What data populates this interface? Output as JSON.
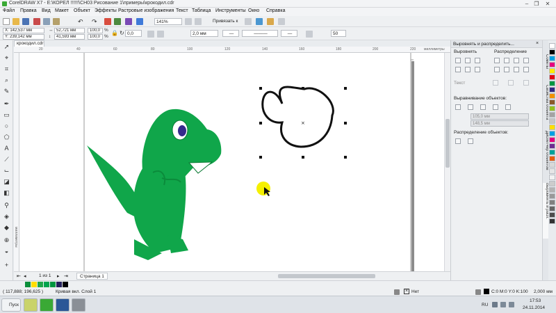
{
  "window": {
    "title": "CorelDRAW X7 - E:\\КОРЕЛ !!!!!!\\CH03 Рисование 1\\примеры\\крокодил.cdr"
  },
  "menu": [
    "Файл",
    "Правка",
    "Вид",
    "Макет",
    "Объект",
    "Эффекты",
    "Растровые изображения",
    "Текст",
    "Таблица",
    "Инструменты",
    "Окно",
    "Справка"
  ],
  "toolbar": {
    "zoom": "141%",
    "snap_label": "Привязать к"
  },
  "propbar": {
    "x": "X: 142,537 мм",
    "y": "Y: 239,142 мм",
    "width": "52,721 мм",
    "height": "41,593 мм",
    "scale_x": "100,0",
    "scale_y": "100,0",
    "pct": "%",
    "rotation": "0,0",
    "outline": "2,0 мм",
    "smoothing": "50"
  },
  "document": {
    "tab": "крокодил.cdr"
  },
  "ruler": {
    "units": "миллиметры",
    "ticks": [
      "20",
      "40",
      "60",
      "80",
      "100",
      "120",
      "140",
      "160",
      "180",
      "200",
      "220"
    ]
  },
  "page_nav": {
    "counter": "1 из 1",
    "page_tab": "Страница 1"
  },
  "docker": {
    "title": "Выровнять и распределить...",
    "align_label": "Выровнять",
    "distribute_label": "Распределение",
    "text_label": "Текст",
    "align_objects_label": "Выравнивание объектов:",
    "coord_x": "105,0 мм",
    "coord_y": "148,5 мм",
    "distribute_objects_label": "Распределение объектов:"
  },
  "vertical_tabs": [
    "Советы",
    "Свойства объекта",
    "Диспетчер объектов",
    "Выровнять и расп."
  ],
  "palette": {
    "colors": [
      "#ffffff",
      "#000000",
      "#00a0e3",
      "#e6007e",
      "#ffed00",
      "#e30613",
      "#009640",
      "#312783",
      "#f39200",
      "#8b5a2b",
      "#95c11f",
      "#a3a3a3",
      "#c6c6c6",
      "#ffde00",
      "#009fe3",
      "#e5007d",
      "#6f2c91",
      "#00a19a",
      "#ea5b0c",
      "#d9d9d9",
      "#e6e6e6",
      "#f2f2f2",
      "#cccccc",
      "#b3b3b3",
      "#999999",
      "#808080",
      "#666666",
      "#4d4d4d",
      "#333333"
    ]
  },
  "doc_palette": {
    "colors": [
      "#0b8f3c",
      "#ffde00",
      "#1fa64a",
      "#00a34e",
      "#009640",
      "#25215c",
      "#000000"
    ]
  },
  "status": {
    "coords": "( 117,888; 196,625 )",
    "object_info": "Кривая вкл. Слой 1",
    "fill_none": "Нет",
    "color_model": "C:0 M:0 Y:0 K:100",
    "outline_width": "2,000 мм"
  },
  "taskbar": {
    "start": "Пуск",
    "lang": "RU",
    "time": "17:53",
    "date": "24.11.2014"
  },
  "colors": {
    "accent": "#3aa935",
    "croc_green": "#10a64a",
    "canvas": "#ffffff",
    "highlight": "#f5f000"
  },
  "icons": [
    "pick-tool-icon",
    "shape-tool-icon",
    "crop-tool-icon",
    "zoom-tool-icon",
    "freehand-tool-icon",
    "rectangle-tool-icon",
    "ellipse-tool-icon",
    "polygon-tool-icon",
    "text-tool-icon",
    "fill-tool-icon",
    "eyedropper-tool-icon"
  ]
}
